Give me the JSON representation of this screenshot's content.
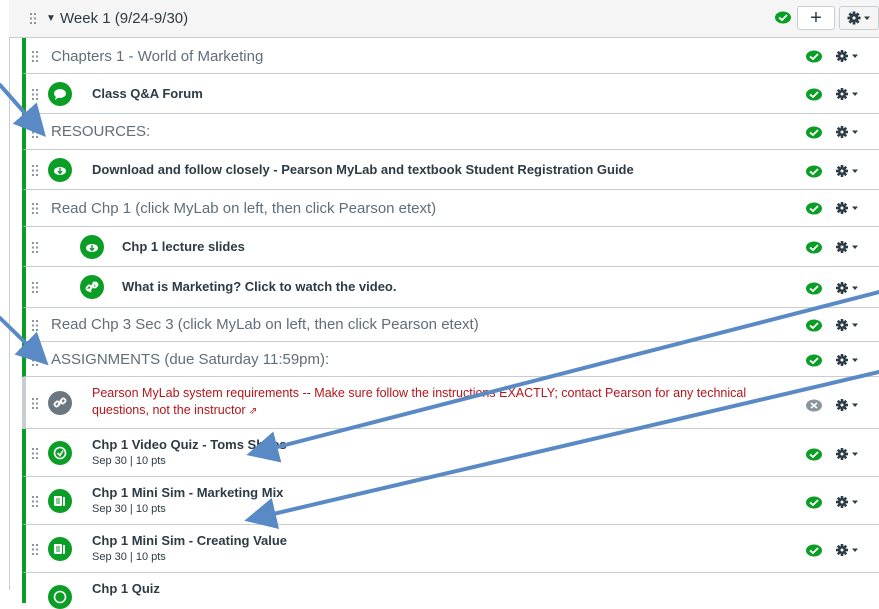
{
  "module": {
    "title": "Week 1 (9/24-9/30)",
    "add_label": "+"
  },
  "items": [
    {
      "kind": "header",
      "title": "Chapters 1 - World of Marketing"
    },
    {
      "kind": "item",
      "icon": "discussion-icon",
      "title": "Class Q&A Forum"
    },
    {
      "kind": "header",
      "title": "RESOURCES:"
    },
    {
      "kind": "item",
      "icon": "download-icon",
      "title": "Download and follow closely - Pearson MyLab and textbook Student Registration Guide"
    },
    {
      "kind": "header",
      "title": "Read Chp 1 (click MyLab on left, then click Pearson etext)"
    },
    {
      "kind": "item",
      "icon": "download-icon",
      "title": "Chp 1 lecture slides",
      "indent": true
    },
    {
      "kind": "item",
      "icon": "link-icon",
      "title": "What is Marketing? Click to watch the video.",
      "indent": true
    },
    {
      "kind": "header",
      "title": "Read Chp 3 Sec 3 (click MyLab on left, then click Pearson etext)"
    },
    {
      "kind": "header",
      "title": "ASSIGNMENTS (due Saturday 11:59pm):"
    },
    {
      "kind": "external",
      "icon": "link-icon",
      "title": "Pearson MyLab system requirements -- Make sure follow the instructions EXACTLY; contact Pearson for any technical questions, not the instructor"
    },
    {
      "kind": "assignment",
      "icon": "quiz-icon",
      "title": "Chp 1 Video Quiz - Toms Shoes",
      "meta": "Sep 30  |  10 pts"
    },
    {
      "kind": "assignment",
      "icon": "assignment-icon",
      "title": "Chp 1 Mini Sim - Marketing Mix",
      "meta": "Sep 30  |  10 pts"
    },
    {
      "kind": "assignment",
      "icon": "assignment-icon",
      "title": "Chp 1 Mini Sim - Creating Value",
      "meta": "Sep 30  |  10 pts"
    },
    {
      "kind": "item",
      "icon": "quiz-icon",
      "title": "Chp 1 Quiz"
    }
  ],
  "colors": {
    "published": "#0b9e26",
    "external_link": "#b4151b",
    "annotation_arrow": "#5a8ac6"
  }
}
